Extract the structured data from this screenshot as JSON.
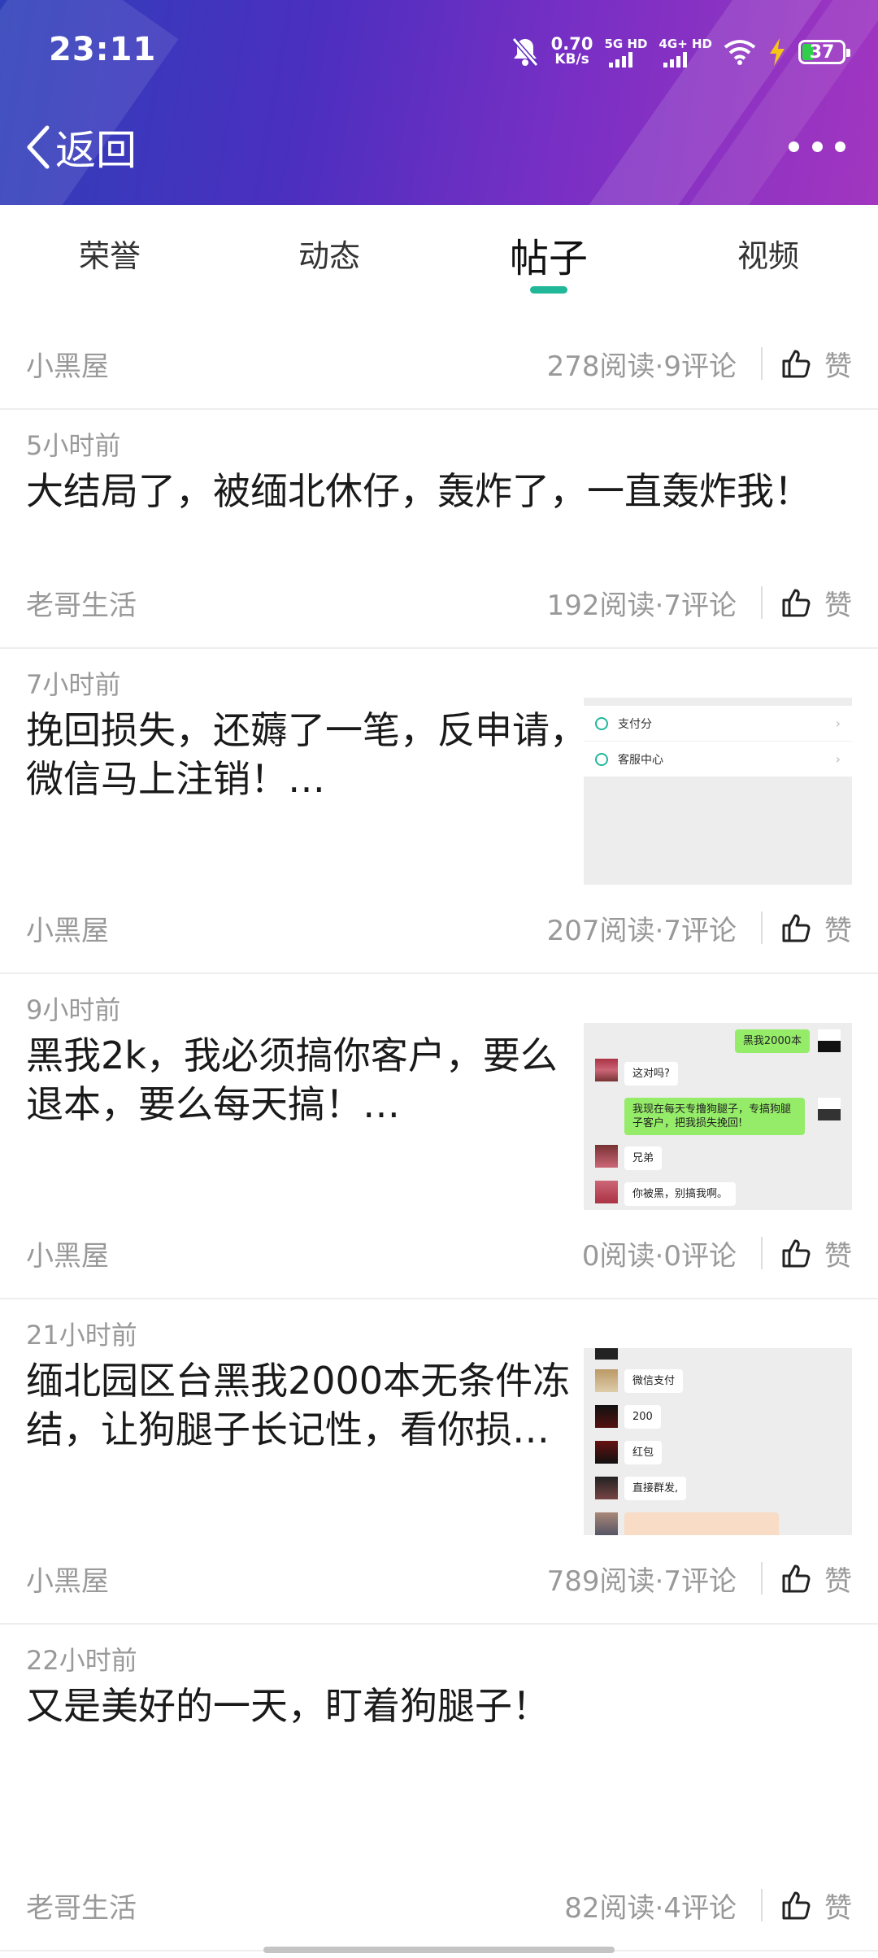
{
  "status_bar": {
    "time": "23:11",
    "net_speed_value": "0.70",
    "net_speed_unit": "KB/s",
    "sim1_label": "5G HD",
    "sim2_label": "4G+ HD",
    "battery": "37",
    "icons": [
      "bell-off-icon",
      "wifi-icon",
      "charging-bolt-icon",
      "battery-icon"
    ]
  },
  "nav": {
    "back_label": "返回",
    "more_icon": "more-dots-icon"
  },
  "tabs": [
    {
      "label": "荣誉",
      "active": false
    },
    {
      "label": "动态",
      "active": false
    },
    {
      "label": "帖子",
      "active": true
    },
    {
      "label": "视频",
      "active": false
    }
  ],
  "accent_color": "#21b89a",
  "like_label": "赞",
  "top_meta": {
    "author": "小黑屋",
    "stats": "278阅读·9评论"
  },
  "posts": [
    {
      "time": "5小时前",
      "title": "大结局了，被缅北休仔，轰炸了，一直轰炸我！",
      "author": "老哥生活",
      "stats": "192阅读·7评论"
    },
    {
      "time": "7小时前",
      "title": "挽回损失，还薅了一笔，反申请，微信马上注销！…",
      "author": "小黑屋",
      "stats": "207阅读·7评论",
      "thumb": {
        "row1": "支付分",
        "row2": "客服中心"
      }
    },
    {
      "time": "9小时前",
      "title": "黑我2k，我必须搞你客户，要么退本，要么每天搞！…",
      "author": "小黑屋",
      "stats": "0阅读·0评论",
      "thumb": {
        "b1": "黑我2000本",
        "b2": "这对吗?",
        "b3": "我现在每天专撸狗腿子，专搞狗腿子客户，把我损失挽回!",
        "b4": "兄弟",
        "b5": "你被黑，别搞我啊。"
      }
    },
    {
      "time": "21小时前",
      "title": "缅北园区台黑我2000本无条件冻结，让狗腿子长记性，看你损…",
      "author": "小黑屋",
      "stats": "789阅读·7评论",
      "thumb": {
        "b1": "微信支付",
        "b2": "200",
        "b3": "红包",
        "b4": "直接群发,"
      }
    },
    {
      "time": "22小时前",
      "title": "又是美好的一天，盯着狗腿子！",
      "author": "老哥生活",
      "stats": "82阅读·4评论"
    }
  ]
}
